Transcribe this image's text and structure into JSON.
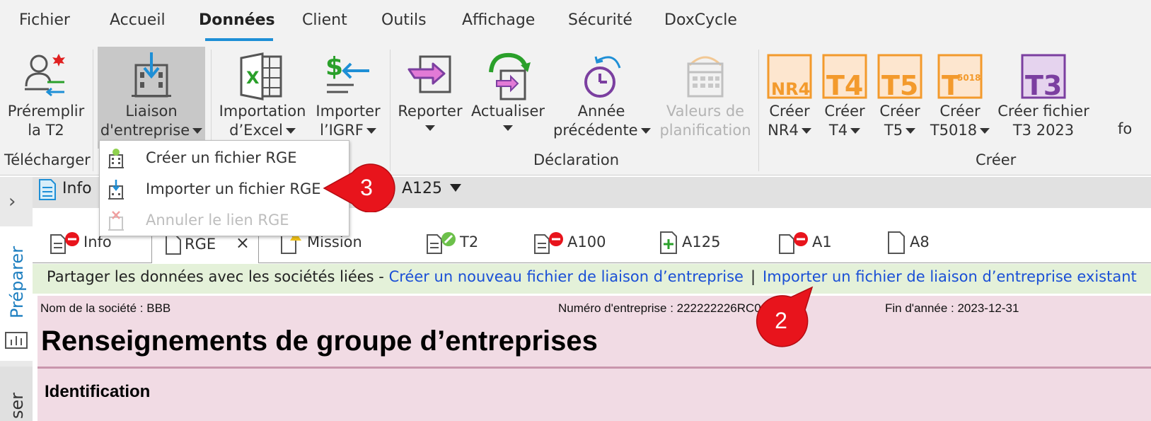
{
  "menu": {
    "tabs": [
      "Fichier",
      "Accueil",
      "Données",
      "Client",
      "Outils",
      "Affichage",
      "Sécurité",
      "DoxCycle"
    ],
    "active": "Données"
  },
  "ribbon": {
    "preremplir": "Préremplir\nla T2",
    "liaison": "Liaison\nd'entreprise",
    "importation_excel": "Importation\nd’Excel",
    "importer_igrf": "Importer\nl’IGRF",
    "reporter": "Reporter",
    "actualiser": "Actualiser",
    "annee_precedente": "Année\nprécédente",
    "valeurs_planification": "Valeurs de\nplanification",
    "creer_nr4": "Créer\nNR4",
    "creer_t4": "Créer\nT4",
    "creer_t5": "Créer\nT5",
    "creer_t5018": "Créer\nT5018",
    "creer_t3": "Créer fichier\nT3 2023",
    "overflow_label": "fo",
    "icon_nr4": "NR4",
    "icon_t4": "T4",
    "icon_t5": "T5",
    "icon_t5018": "5018",
    "icon_t3": "T3",
    "groups": {
      "telecharger": "Télécharger",
      "declaration": "Déclaration",
      "creer": "Créer"
    }
  },
  "dropdown": {
    "items": [
      {
        "label": "Créer un fichier RGE",
        "enabled": true
      },
      {
        "label": "Importer un fichier RGE",
        "enabled": true
      },
      {
        "label": "Annuler le lien RGE",
        "enabled": false
      }
    ]
  },
  "doctabs": {
    "info": "Info",
    "a125": "A125"
  },
  "formtabs": [
    "Info",
    "RGE",
    "Mission",
    "T2",
    "A100",
    "A125",
    "A1",
    "A8"
  ],
  "side": {
    "preparer": "Préparer",
    "other": "ser"
  },
  "sharebar": {
    "prefix": "Partager les données avec les sociétés liées - ",
    "link_create": "Créer un nouveau fichier de liaison d’entreprise",
    "separator": "|",
    "link_import": "Importer un fichier de liaison d’entreprise existant"
  },
  "form": {
    "company": "Nom de la société : BBB",
    "business_number": "Numéro d'entreprise : 222222226RC0",
    "year_end": "Fin d'année : 2023-12-31",
    "title": "Renseignements de groupe d’entreprises",
    "section": "Identification"
  },
  "callouts": {
    "step2": "2",
    "step3": "3"
  },
  "colors": {
    "accent": "#1e8fd6",
    "link": "#1a4fd6",
    "callout": "#e8141c",
    "form_bg": "#f1dbe4",
    "share_bg": "#e4f1d9",
    "orange": "#f39a2c",
    "purple": "#7b3fa0"
  }
}
